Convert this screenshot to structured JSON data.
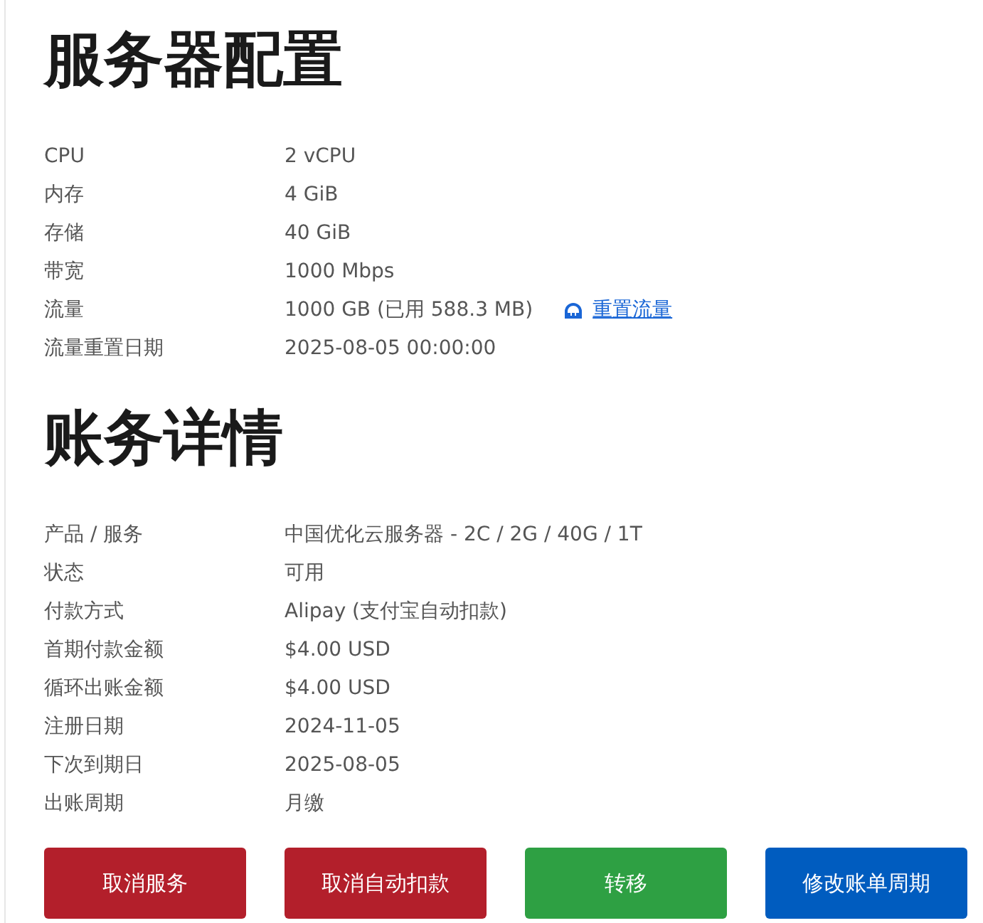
{
  "sections": [
    {
      "title": "服务器配置",
      "rows": [
        {
          "label": "CPU",
          "value": "2 vCPU"
        },
        {
          "label": "内存",
          "value": "4 GiB"
        },
        {
          "label": "存储",
          "value": "40 GiB"
        },
        {
          "label": "带宽",
          "value": "1000 Mbps"
        },
        {
          "label": "流量",
          "value": "1000 GB (已用 588.3 MB)",
          "action": "重置流量"
        },
        {
          "label": "流量重置日期",
          "value": "2025-08-05 00:00:00"
        }
      ]
    },
    {
      "title": "账务详情",
      "rows": [
        {
          "label": "产品 / 服务",
          "value": "中国优化云服务器 - 2C / 2G / 40G / 1T"
        },
        {
          "label": "状态",
          "value": "可用"
        },
        {
          "label": "付款方式",
          "value": "Alipay (支付宝自动扣款)"
        },
        {
          "label": "首期付款金额",
          "value": "$4.00 USD"
        },
        {
          "label": "循环出账金额",
          "value": "$4.00 USD"
        },
        {
          "label": "注册日期",
          "value": "2024-11-05"
        },
        {
          "label": "下次到期日",
          "value": "2025-08-05"
        },
        {
          "label": "出账周期",
          "value": "月缴"
        }
      ]
    }
  ],
  "buttons": [
    {
      "label": "取消服务",
      "kind": "danger"
    },
    {
      "label": "取消自动扣款",
      "kind": "danger"
    },
    {
      "label": "转移",
      "kind": "success"
    },
    {
      "label": "修改账单周期",
      "kind": "primary"
    }
  ]
}
